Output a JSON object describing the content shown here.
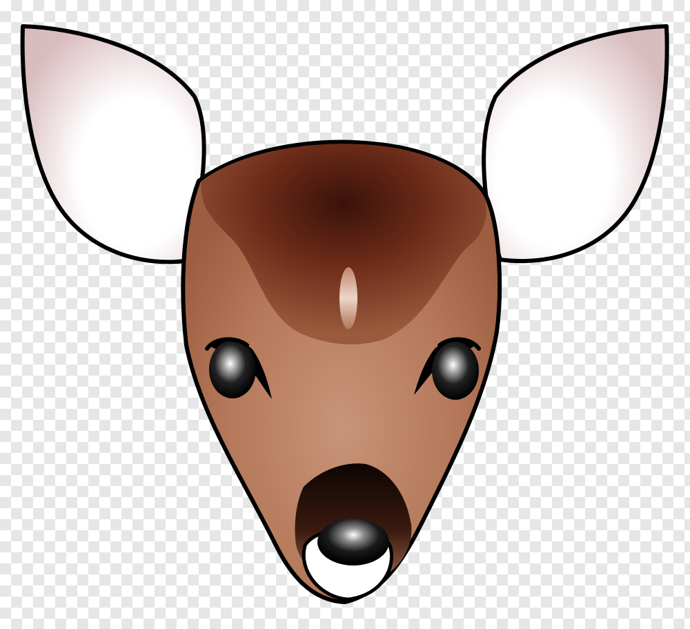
{
  "image": {
    "subject": "deer-fawn-head-clipart",
    "background": "transparency-checkerboard",
    "colors": {
      "outline": "#000000",
      "ear_inner": "#e3c9cb",
      "face_light": "#c2876a",
      "face_mid": "#a8684a",
      "face_dark": "#5a1f12",
      "muzzle_dark": "#1b0b06",
      "eye": "#101010",
      "nose_white": "#ffffff",
      "checker_light": "#ffffff",
      "checker_dark": "#e6e6e6"
    }
  }
}
